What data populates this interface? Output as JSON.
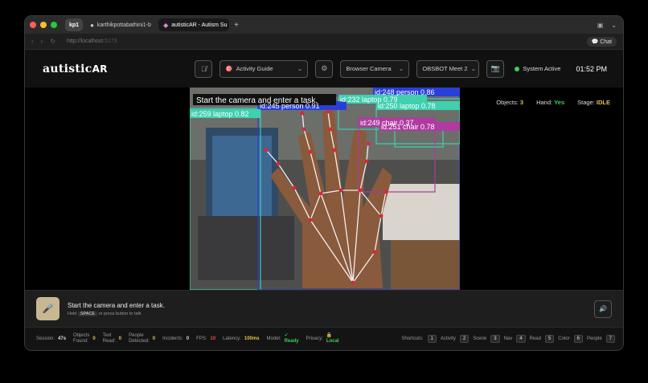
{
  "browser": {
    "profile_tab": "kp1",
    "tabs": [
      {
        "label": "karthikpottabathini1-b",
        "icon": "github-icon"
      },
      {
        "label": "autisticAR - Autism Su",
        "icon": "app-icon"
      }
    ],
    "url_host": "http://localhost",
    "url_port": ":5173",
    "chat_label": "Chat"
  },
  "header": {
    "logo_main": "autistic",
    "logo_ar": "AR",
    "activity_guide": "Activity Guide",
    "camera_source": "Browser Camera",
    "meeting": "OBSBOT Meet 2",
    "status": "System Active",
    "time": "01:52 PM"
  },
  "video": {
    "instruction": "Start the camera and enter a task.",
    "detections": [
      {
        "label": "id:248 person 0.86"
      },
      {
        "label": "id:232 laptop 0.79"
      },
      {
        "label": "id:250 laptop 0.78"
      },
      {
        "label": "id:245 person 0.91"
      },
      {
        "label": "id:259 laptop 0.82"
      },
      {
        "label": "id:249 chair 0.37"
      },
      {
        "label": "id:251 chair 0.78"
      }
    ]
  },
  "overlay": {
    "objects_label": "Objects:",
    "objects_value": "3",
    "hand_label": "Hand:",
    "hand_value": "Yes",
    "stage_label": "Stage:",
    "stage_value": "IDLE"
  },
  "prompt": {
    "main": "Start the camera and enter a task.",
    "hint_prefix": "Hold",
    "hint_key": "SPACE",
    "hint_suffix": "or press button to talk"
  },
  "footer": {
    "session_label": "Session:",
    "session_value": "47s",
    "objects_label_1": "Objects",
    "objects_label_2": "Found:",
    "objects_value": "0",
    "text_label_1": "Text",
    "text_label_2": "Read:",
    "text_value": "0",
    "people_label_1": "People",
    "people_label_2": "Detected:",
    "people_value": "0",
    "incidents_label": "Incidents:",
    "incidents_value": "0",
    "fps_label": "FPS:",
    "fps_value": "10",
    "latency_label": "Latency:",
    "latency_value": "100ms",
    "model_label": "Model:",
    "model_check": "✓",
    "model_value": "Ready",
    "privacy_label": "Privacy:",
    "privacy_value": "Local",
    "shortcuts_label": "Shortcuts:",
    "shortcuts": [
      {
        "key": "1",
        "label": "Activity"
      },
      {
        "key": "2",
        "label": "Scene"
      },
      {
        "key": "3",
        "label": "Nav"
      },
      {
        "key": "4",
        "label": "Read"
      },
      {
        "key": "5",
        "label": "Color"
      },
      {
        "key": "6",
        "label": "People"
      },
      {
        "key": "7",
        "label": ""
      }
    ]
  },
  "colors": {
    "accent_green": "#3ecf5a",
    "stage_yellow": "#e6c34a",
    "mic_bg": "#c8b892",
    "fps_red": "#e0533d"
  }
}
